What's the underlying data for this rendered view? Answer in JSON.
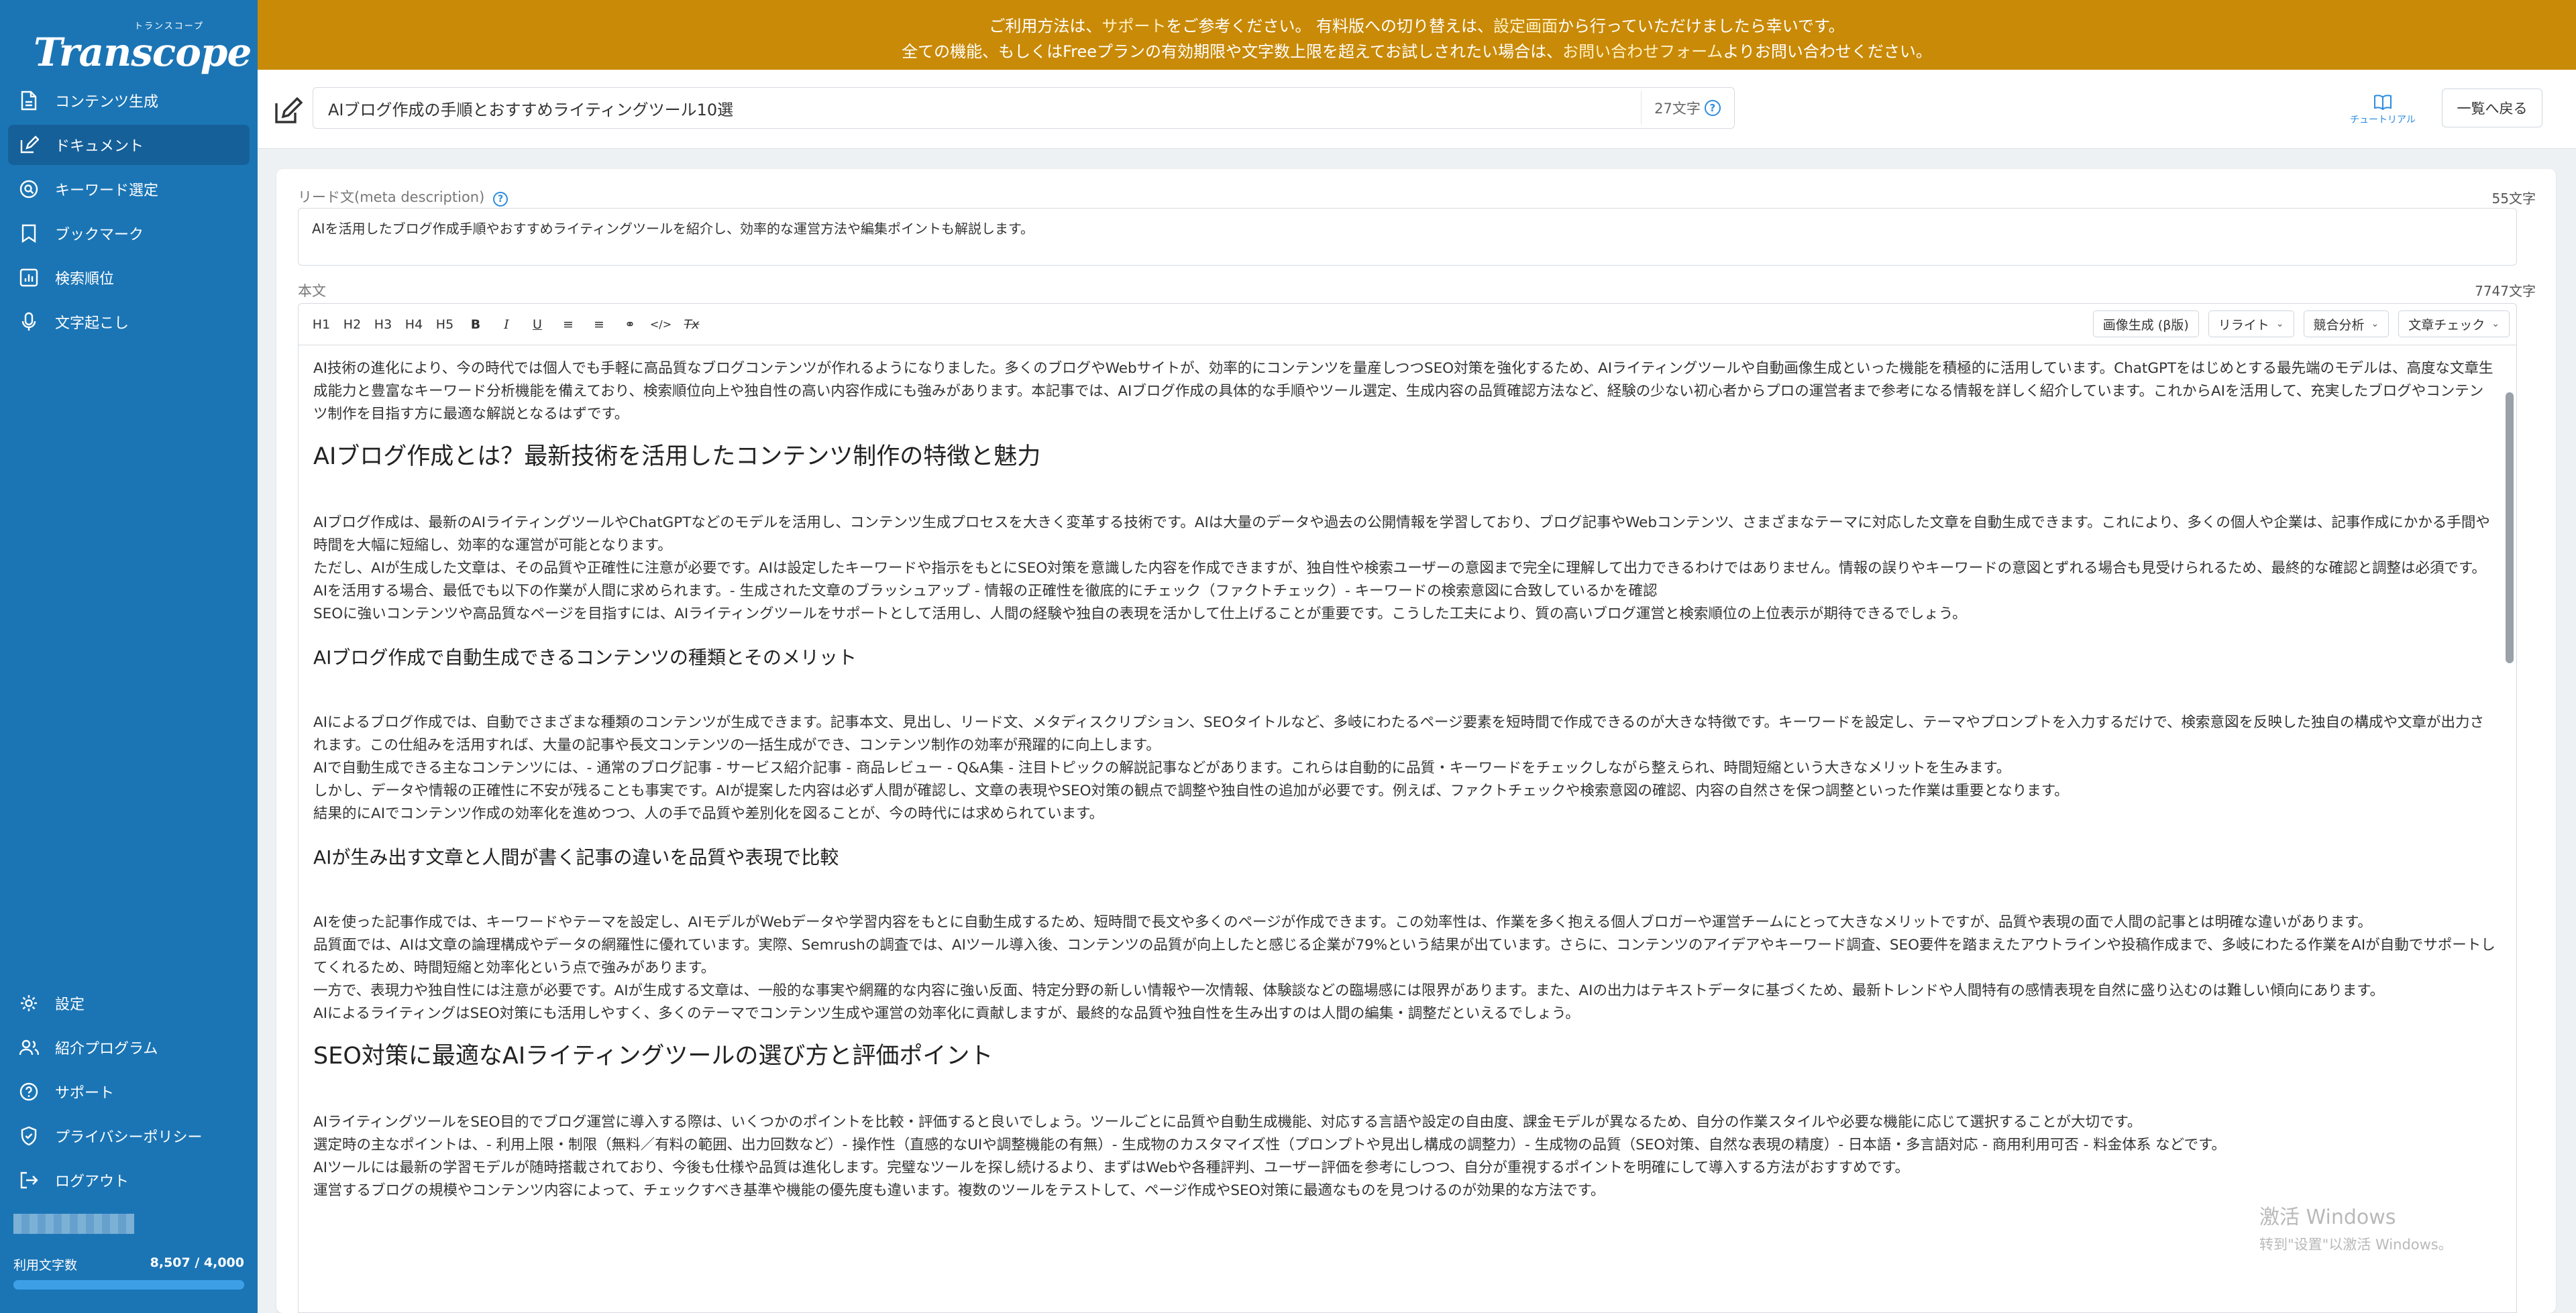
{
  "sidebar": {
    "logo_kana": "トランスコープ",
    "logo_text": "Transcope",
    "items": [
      {
        "label": "コンテンツ生成"
      },
      {
        "label": "ドキュメント"
      },
      {
        "label": "キーワード選定"
      },
      {
        "label": "ブックマーク"
      },
      {
        "label": "検索順位"
      },
      {
        "label": "文字起こし"
      }
    ],
    "bottom_items": [
      {
        "label": "設定"
      },
      {
        "label": "紹介プログラム"
      },
      {
        "label": "サポート"
      },
      {
        "label": "プライバシーポリシー"
      },
      {
        "label": "ログアウト"
      }
    ],
    "usage_label": "利用文字数",
    "usage_value": "8,507 / 4,000",
    "usage_fraction": 1.0,
    "colors": {
      "background": "#1b75b5",
      "active": "#16609a"
    }
  },
  "banner": {
    "line1_a": "ご利用方法は、",
    "line1_link1": "サポート",
    "line1_b": "をご参考ください。 有料版への切り替えは、",
    "line1_link2": "設定画面",
    "line1_c": "から行っていただけましたら幸いです。",
    "line2_a": "全ての機能、もしくはFreeプランの有効期限や文字数上限を超えてお試しされたい場合は、",
    "line2_link": "お問い合わせフォーム",
    "line2_b": "よりお問い合わせください。",
    "color": "#c98a07"
  },
  "header": {
    "title_value": "AIブログ作成の手順とおすすめライティングツール10選",
    "title_count": "27文字",
    "tutorial_label": "チュートリアル",
    "back_label": "一覧へ戻る"
  },
  "meta": {
    "label": "リード文(meta description)",
    "count": "55文字",
    "value": "AIを活用したブログ作成手順やおすすめライティングツールを紹介し、効率的な運営方法や編集ポイントも解説します。"
  },
  "body": {
    "label": "本文",
    "count": "7747文字",
    "toolbar": {
      "h1": "H1",
      "h2": "H2",
      "h3": "H3",
      "h4": "H4",
      "h5": "H5",
      "bold": "B",
      "italic": "I",
      "underline": "U",
      "ol": "≡",
      "ul": "≡",
      "link": "⚭",
      "code": "</>",
      "clear": "Tx"
    },
    "actions": [
      {
        "label": "画像生成 (β版)"
      },
      {
        "label": "リライト"
      },
      {
        "label": "競合分析"
      },
      {
        "label": "文章チェック"
      }
    ],
    "blocks": {
      "p0": "AI技術の進化により、今の時代では個人でも手軽に高品質なブログコンテンツが作れるようになりました。多くのブログやWebサイトが、効率的にコンテンツを量産しつつSEO対策を強化するため、AIライティングツールや自動画像生成といった機能を積極的に活用しています。ChatGPTをはじめとする最先端のモデルは、高度な文章生成能力と豊富なキーワード分析機能を備えており、検索順位向上や独自性の高い内容作成にも強みがあります。本記事では、AIブログ作成の具体的な手順やツール選定、生成内容の品質確認方法など、経験の少ない初心者からプロの運営者まで参考になる情報を詳しく紹介しています。これからAIを活用して、充実したブログやコンテンツ制作を目指す方に最適な解説となるはずです。",
      "h2_1": "AIブログ作成とは？最新技術を活用したコンテンツ制作の特徴と魅力",
      "p1": "AIブログ作成は、最新のAIライティングツールやChatGPTなどのモデルを活用し、コンテンツ生成プロセスを大きく変革する技術です。AIは大量のデータや過去の公開情報を学習しており、ブログ記事やWebコンテンツ、さまざまなテーマに対応した文章を自動生成できます。これにより、多くの個人や企業は、記事作成にかかる手間や時間を大幅に短縮し、効率的な運営が可能となります。",
      "p2": "ただし、AIが生成した文章は、その品質や正確性に注意が必要です。AIは設定したキーワードや指示をもとにSEO対策を意識した内容を作成できますが、独自性や検索ユーザーの意図まで完全に理解して出力できるわけではありません。情報の誤りやキーワードの意図とずれる場合も見受けられるため、最終的な確認と調整は必須です。",
      "p3": "AIを活用する場合、最低でも以下の作業が人間に求められます。- 生成された文章のブラッシュアップ - 情報の正確性を徹底的にチェック（ファクトチェック）- キーワードの検索意図に合致しているかを確認",
      "p4": "SEOに強いコンテンツや高品質なページを目指すには、AIライティングツールをサポートとして活用し、人間の経験や独自の表現を活かして仕上げることが重要です。こうした工夫により、質の高いブログ運営と検索順位の上位表示が期待できるでしょう。",
      "h3_1": "AIブログ作成で自動生成できるコンテンツの種類とそのメリット",
      "p5": "AIによるブログ作成では、自動でさまざまな種類のコンテンツが生成できます。記事本文、見出し、リード文、メタディスクリプション、SEOタイトルなど、多岐にわたるページ要素を短時間で作成できるのが大きな特徴です。キーワードを設定し、テーマやプロンプトを入力するだけで、検索意図を反映した独自の構成や文章が出力されます。この仕組みを活用すれば、大量の記事や長文コンテンツの一括生成ができ、コンテンツ制作の効率が飛躍的に向上します。",
      "p6": "AIで自動生成できる主なコンテンツには、- 通常のブログ記事 - サービス紹介記事 - 商品レビュー - Q&A集 - 注目トピックの解説記事などがあります。これらは自動的に品質・キーワードをチェックしながら整えられ、時間短縮という大きなメリットを生みます。",
      "p7": "しかし、データや情報の正確性に不安が残ることも事実です。AIが提案した内容は必ず人間が確認し、文章の表現やSEO対策の観点で調整や独自性の追加が必要です。例えば、ファクトチェックや検索意図の確認、内容の自然さを保つ調整といった作業は重要となります。",
      "p8": "結果的にAIでコンテンツ作成の効率化を進めつつ、人の手で品質や差別化を図ることが、今の時代には求められています。",
      "h3_2": "AIが生み出す文章と人間が書く記事の違いを品質や表現で比較",
      "p9": "AIを使った記事作成では、キーワードやテーマを設定し、AIモデルがWebデータや学習内容をもとに自動生成するため、短時間で長文や多くのページが作成できます。この効率性は、作業を多く抱える個人ブロガーや運営チームにとって大きなメリットですが、品質や表現の面で人間の記事とは明確な違いがあります。",
      "p10": "品質面では、AIは文章の論理構成やデータの網羅性に優れています。実際、Semrushの調査では、AIツール導入後、コンテンツの品質が向上したと感じる企業が79%という結果が出ています。さらに、コンテンツのアイデアやキーワード調査、SEO要件を踏まえたアウトラインや投稿作成まで、多岐にわたる作業をAIが自動でサポートしてくれるため、時間短縮と効率化という点で強みがあります。",
      "p11": "一方で、表現力や独自性には注意が必要です。AIが生成する文章は、一般的な事実や網羅的な内容に強い反面、特定分野の新しい情報や一次情報、体験談などの臨場感には限界があります。また、AIの出力はテキストデータに基づくため、最新トレンドや人間特有の感情表現を自然に盛り込むのは難しい傾向にあります。",
      "p12": "AIによるライティングはSEO対策にも活用しやすく、多くのテーマでコンテンツ生成や運営の効率化に貢献しますが、最終的な品質や独自性を生み出すのは人間の編集・調整だといえるでしょう。",
      "h2_2": "SEO対策に最適なAIライティングツールの選び方と評価ポイント",
      "p13": "AIライティングツールをSEO目的でブログ運営に導入する際は、いくつかのポイントを比較・評価すると良いでしょう。ツールごとに品質や自動生成機能、対応する言語や設定の自由度、課金モデルが異なるため、自分の作業スタイルや必要な機能に応じて選択することが大切です。",
      "p14": "選定時の主なポイントは、- 利用上限・制限（無料／有料の範囲、出力回数など）- 操作性（直感的なUIや調整機能の有無）- 生成物のカスタマイズ性（プロンプトや見出し構成の調整力）- 生成物の品質（SEO対策、自然な表現の精度）- 日本語・多言語対応 - 商用利用可否 - 料金体系 などです。",
      "p15": "AIツールには最新の学習モデルが随時搭載されており、今後も仕様や品質は進化します。完璧なツールを探し続けるより、まずはWebや各種評判、ユーザー評価を参考にしつつ、自分が重視するポイントを明確にして導入する方法がおすすめです。",
      "p16": "運営するブログの規模やコンテンツ内容によって、チェックすべき基準や機能の優先度も違います。複数のツールをテストして、ページ作成やSEO対策に最適なものを見つけるのが効果的な方法です。"
    }
  },
  "watermark": {
    "line1": "激活 Windows",
    "line2": "转到\"设置\"以激活 Windows。"
  }
}
